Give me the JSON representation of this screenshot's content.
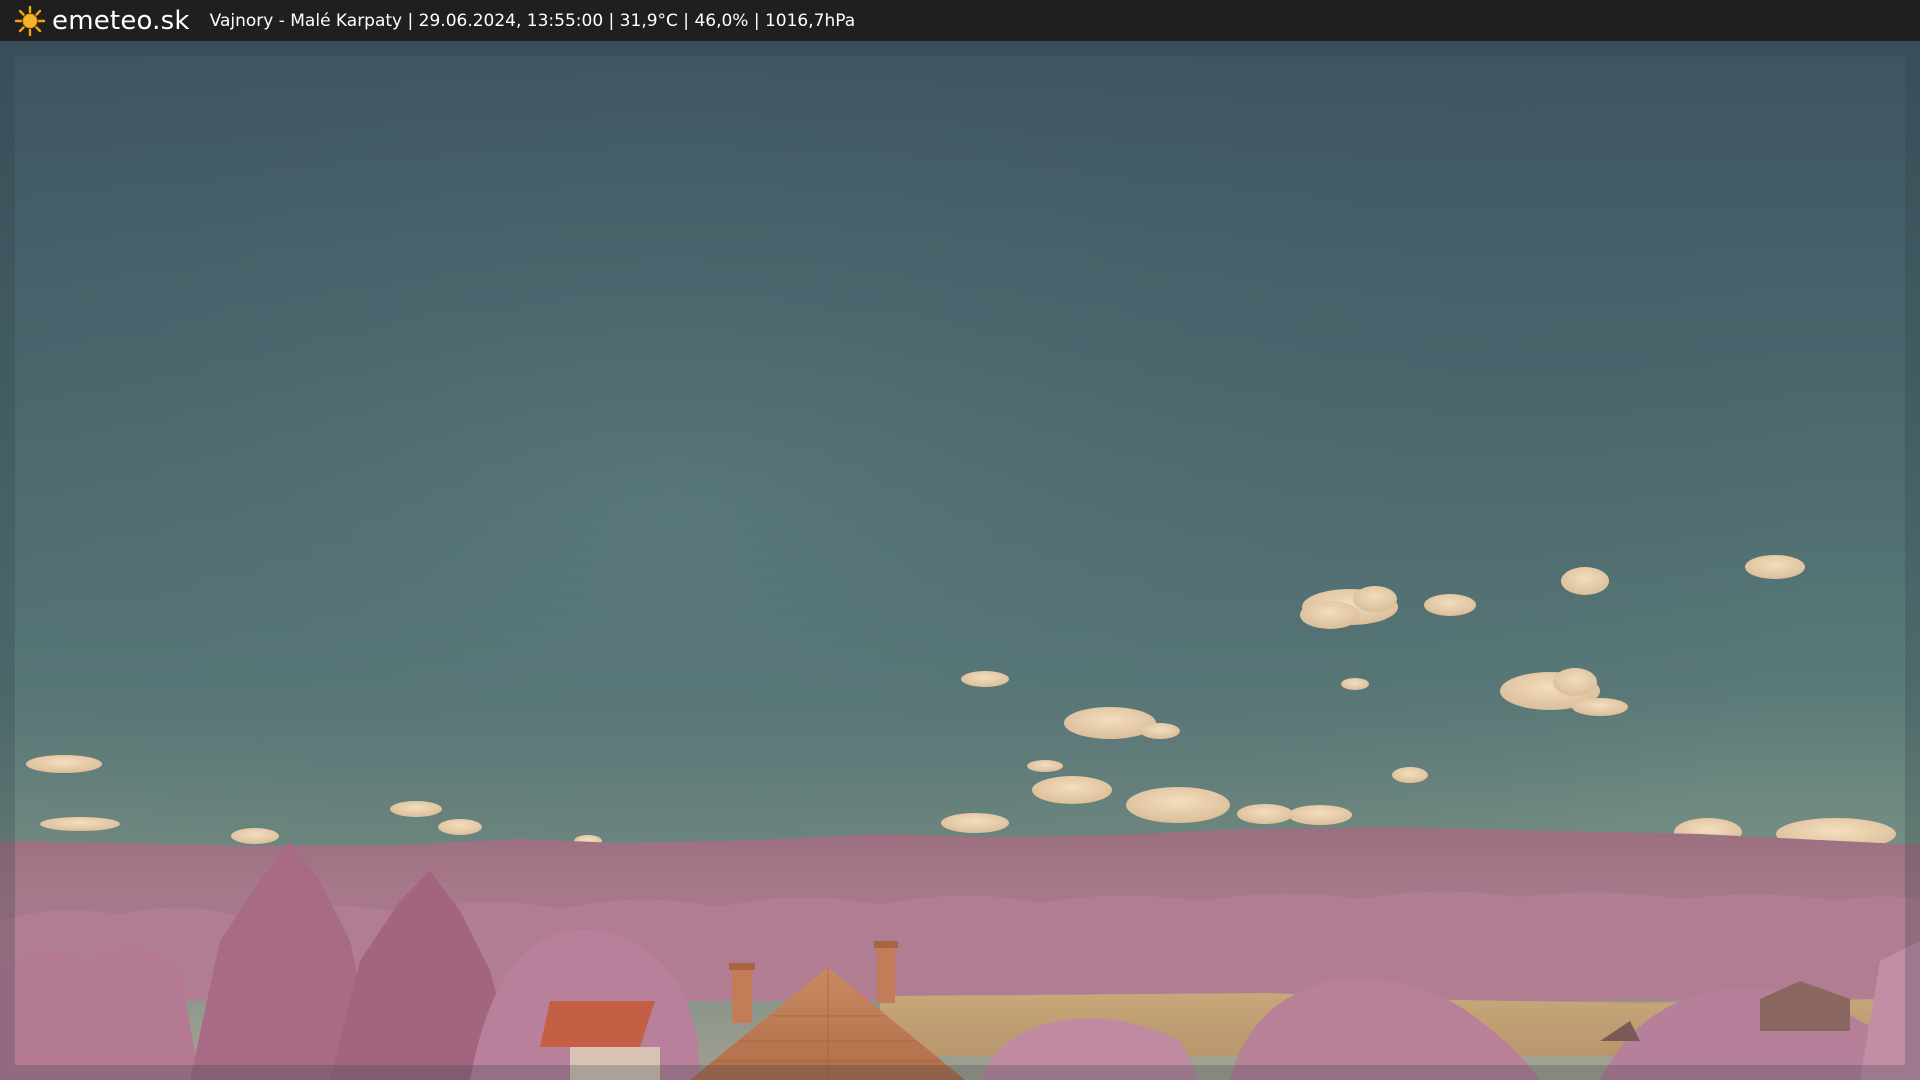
{
  "header": {
    "brand": "emeteo.sk",
    "logo_icon": "sun-icon",
    "caption": "Vajnory - Malé Karpaty | 29.06.2024, 13:55:00 | 31,9°C | 46,0% | 1016,7hPa"
  },
  "colors": {
    "bar_bg": "#1f1f1f",
    "sun": "#f2a60c",
    "sky_top": "#3e5563",
    "sky_mid": "#4d6b70",
    "sky_horizon": "#8a9b8e",
    "foliage": "#b57890",
    "roof": "#c67a52",
    "field": "#c9a77a"
  }
}
